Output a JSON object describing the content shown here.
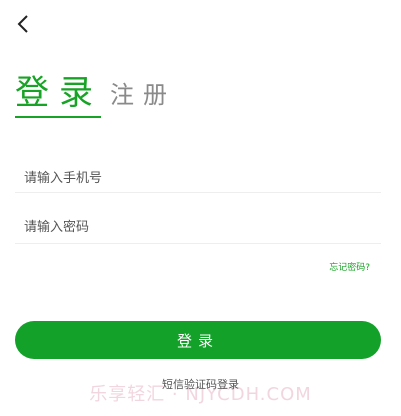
{
  "header": {
    "back_icon": "chevron-left-icon"
  },
  "tabs": {
    "login_label": "登录",
    "register_label": "注册"
  },
  "form": {
    "phone_placeholder": "请输入手机号",
    "password_placeholder": "请输入密码",
    "forgot_label": "忘记密码?"
  },
  "actions": {
    "login_button": "登录",
    "sms_login": "短信验证码登录"
  },
  "watermark": {
    "text": "乐享轻汇 · NJYCDH.COM"
  },
  "colors": {
    "accent": "#17a325",
    "button": "#13a12a"
  }
}
